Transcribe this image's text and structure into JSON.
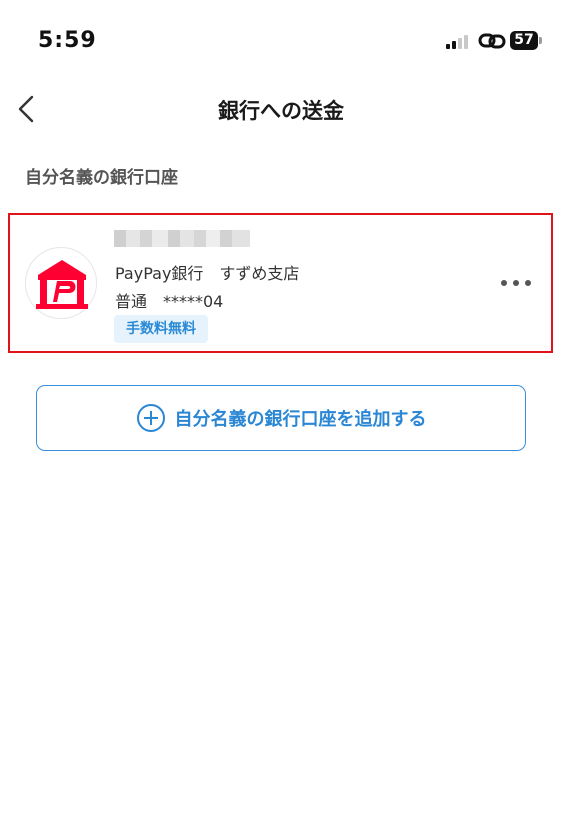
{
  "status_bar": {
    "time": "5:59",
    "battery_level": "57"
  },
  "nav": {
    "title": "銀行への送金",
    "back_icon": "chevron-left-icon"
  },
  "section": {
    "label": "自分名義の銀行口座"
  },
  "account": {
    "bank_logo": "paypay-bank-logo",
    "bank_branch": "PayPay銀行　すずめ支店",
    "account_number": "普通　*****04",
    "fee_badge": "手数料無料",
    "more_icon": "more-horizontal-icon"
  },
  "add_account": {
    "label": "自分名義の銀行口座を追加する",
    "icon": "plus-circle-icon"
  },
  "colors": {
    "accent_blue": "#2b87d3",
    "highlight_red": "#e0121a",
    "paypay_red": "#ff0033",
    "badge_bg": "#e6f3fc"
  }
}
